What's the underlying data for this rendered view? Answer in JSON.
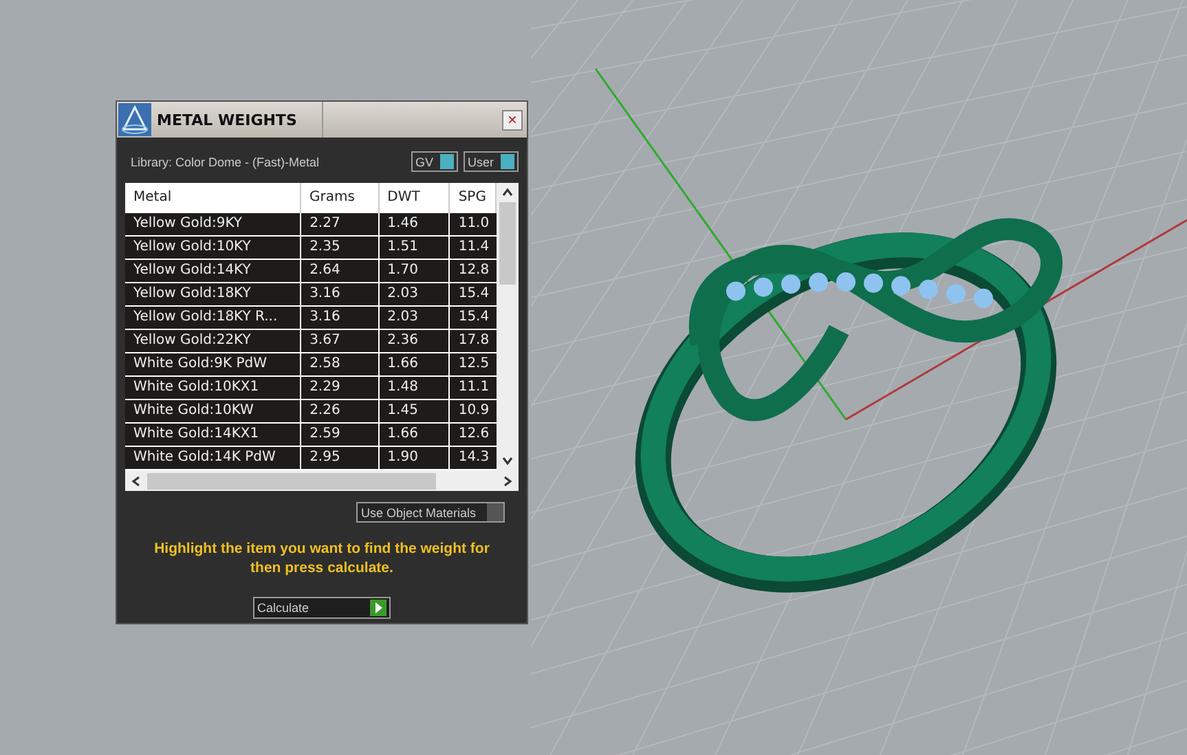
{
  "window": {
    "title": "METAL WEIGHTS",
    "close": "×"
  },
  "library": "Library: Color Dome - (Fast)-Metal",
  "toggles": [
    {
      "label": "GV",
      "on": true
    },
    {
      "label": "User",
      "on": true
    }
  ],
  "table": {
    "columns": [
      "Metal",
      "Grams",
      "DWT",
      "SPG"
    ],
    "rows": [
      [
        "Yellow Gold:9KY",
        "2.27",
        "1.46",
        "11.0"
      ],
      [
        "Yellow Gold:10KY",
        "2.35",
        "1.51",
        "11.4"
      ],
      [
        "Yellow Gold:14KY",
        "2.64",
        "1.70",
        "12.8"
      ],
      [
        "Yellow Gold:18KY",
        "3.16",
        "2.03",
        "15.4"
      ],
      [
        "Yellow Gold:18KY R...",
        "3.16",
        "2.03",
        "15.4"
      ],
      [
        "Yellow Gold:22KY",
        "3.67",
        "2.36",
        "17.8"
      ],
      [
        "White Gold:9K PdW",
        "2.58",
        "1.66",
        "12.5"
      ],
      [
        "White Gold:10KX1",
        "2.29",
        "1.48",
        "11.1"
      ],
      [
        "White Gold:10KW",
        "2.26",
        "1.45",
        "10.9"
      ],
      [
        "White Gold:14KX1",
        "2.59",
        "1.66",
        "12.6"
      ],
      [
        "White Gold:14K PdW",
        "2.95",
        "1.90",
        "14.3"
      ]
    ]
  },
  "use_object_materials": {
    "label": "Use Object Materials",
    "on": false
  },
  "hint": "Highlight the item you want to find the weight for then press calculate.",
  "calculate": {
    "label": "Calculate"
  }
}
